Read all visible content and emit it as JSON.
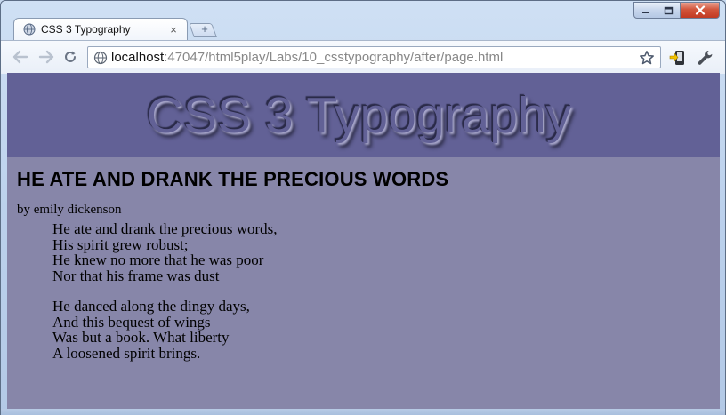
{
  "browser": {
    "tab": {
      "title": "CSS 3 Typography",
      "close_glyph": "×",
      "favicon": "globe-icon"
    },
    "new_tab_glyph": "+",
    "url": {
      "host": "localhost",
      "path": ":47047/html5play/Labs/10_csstypography/after/page.html"
    }
  },
  "page": {
    "banner_title": "CSS 3 Typography",
    "poem_title": "HE ATE AND DRANK THE PRECIOUS WORDS",
    "author": "by emily dickenson",
    "stanzas": [
      {
        "lines": [
          "He ate and drank the precious words,",
          "His spirit grew robust;",
          "He knew no more that he was poor",
          "Nor that his frame was dust"
        ]
      },
      {
        "lines": [
          "He danced along the dingy days,",
          "And this bequest of wings",
          "Was but a book. What liberty",
          "A loosened spirit brings."
        ]
      }
    ]
  },
  "colors": {
    "banner_bg": "#626196",
    "page_bg": "#8786a9"
  }
}
